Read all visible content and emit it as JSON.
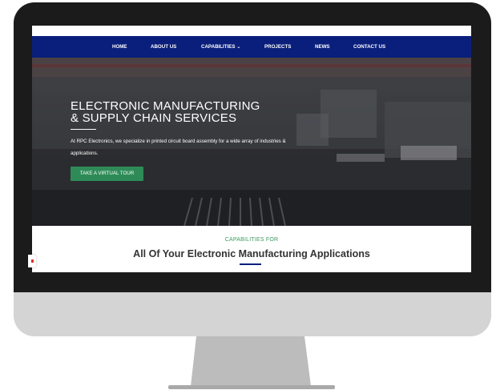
{
  "nav": {
    "items": [
      {
        "label": "HOME"
      },
      {
        "label": "ABOUT US"
      },
      {
        "label": "CAPABILITIES ⌄"
      },
      {
        "label": "PROJECTS"
      },
      {
        "label": "NEWS"
      },
      {
        "label": "CONTACT US"
      }
    ]
  },
  "hero": {
    "title_line1": "ELECTRONIC MANUFACTURING",
    "title_line2": "& SUPPLY CHAIN SERVICES",
    "text": "At RPC Electronics, we specialize in printed circuit board assembly for a wide array of industries & applications.",
    "cta_label": "TAKE A VIRTUAL TOUR"
  },
  "capabilities": {
    "eyebrow": "CAPABILITIES FOR",
    "title": "All Of Your Electronic Manufacturing Applications"
  },
  "colors": {
    "nav_bg": "#0a1f7c",
    "cta_bg": "#2e8b57",
    "eyebrow": "#3c9a5f",
    "monitor_bezel": "#1b1b1b",
    "monitor_body": "#d4d4d4",
    "stand": "#bdbdbd"
  }
}
